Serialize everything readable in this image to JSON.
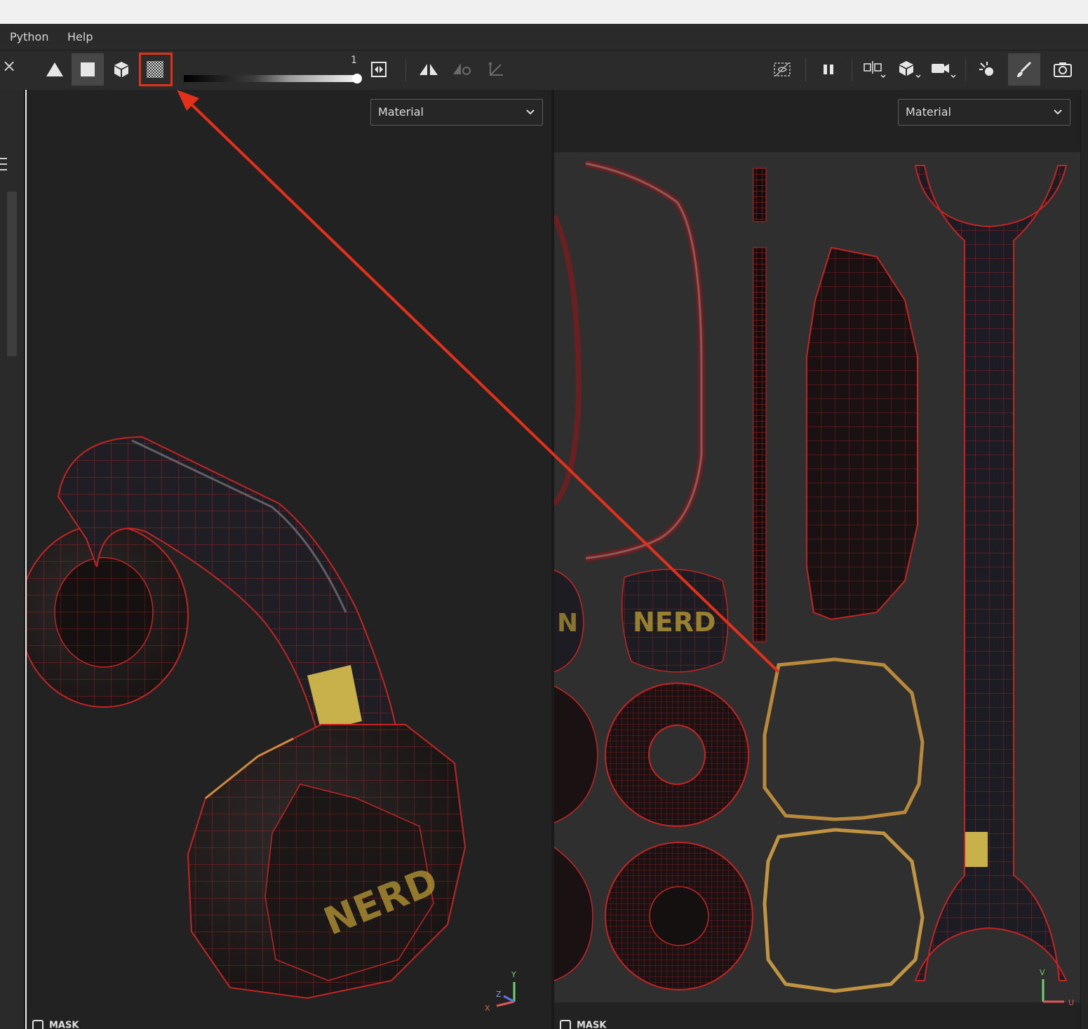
{
  "menu": {
    "items": [
      {
        "label": "Python"
      },
      {
        "label": "Help"
      }
    ]
  },
  "toolbar": {
    "close_glyph": "×",
    "slider_value": "1",
    "slider_level": 1.0,
    "buttons_left": [
      "mesh-triangle-icon",
      "solid-square-icon",
      "cube-icon",
      "checker-texture-icon"
    ],
    "buttons_mid": [
      "swap-texture-icon",
      "symmetry-icon",
      "symmetry-settings-icon",
      "rotate-axis-icon"
    ],
    "buttons_right": [
      "hide-wireframe-icon",
      "pause-icon",
      "split-view-icon",
      "display-cube-icon",
      "camera-icon",
      "lights-icon",
      "paint-brush-icon",
      "screenshot-icon"
    ],
    "highlight_color": "#e2301b"
  },
  "viewport3d": {
    "channel": "Material",
    "mask_label": "MASK",
    "axis_labels": {
      "y": "Y",
      "z": "Z",
      "x": "X"
    },
    "logo_text": "NERD"
  },
  "viewport2d": {
    "channel": "Material",
    "mask_label": "MASK",
    "axis_labels": {
      "v": "V",
      "u": "U"
    },
    "logo_text": "NERD",
    "partial_text": "N"
  },
  "colors": {
    "wire": "#c42424",
    "accent_gold": "#d9b24a",
    "arrow": "#e2301b"
  }
}
